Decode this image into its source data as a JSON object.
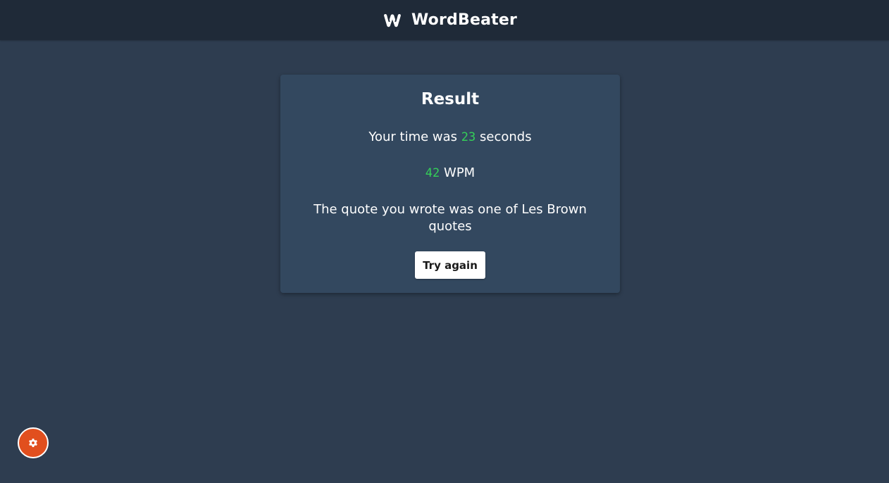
{
  "app": {
    "name": "WordBeater",
    "logo_icon": "w-logo-icon"
  },
  "result": {
    "title": "Result",
    "time_prefix": "Your time was",
    "time_value": "23",
    "time_suffix": "seconds",
    "wpm_value": "42",
    "wpm_label": "WPM",
    "quote_line_1": "The quote you wrote was one of Les Brown",
    "quote_line_2": "quotes",
    "try_again_label": "Try again"
  },
  "settings": {
    "icon": "gear-icon"
  },
  "colors": {
    "background": "#2e3d50",
    "navbar": "#1f2a38",
    "card": "#33485f",
    "accent_green": "#34d058",
    "fab": "#e14f1e"
  }
}
